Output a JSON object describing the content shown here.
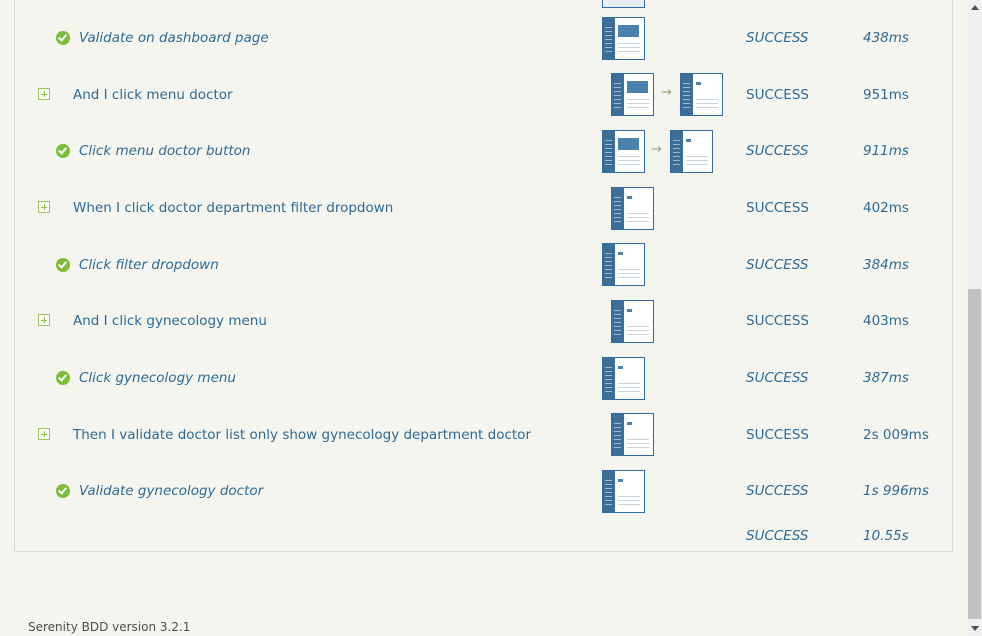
{
  "steps": [
    {
      "kind": "sub",
      "label": "Validate on dashboard page",
      "status": "SUCCESS",
      "time": "438ms",
      "thumbs": [
        "dashboard"
      ]
    },
    {
      "kind": "step",
      "label": "And I click menu doctor",
      "status": "SUCCESS",
      "time": "951ms",
      "thumbs": [
        "dashboard",
        "doctor"
      ]
    },
    {
      "kind": "sub",
      "label": "Click menu doctor button",
      "status": "SUCCESS",
      "time": "911ms",
      "thumbs": [
        "dashboard",
        "doctor"
      ]
    },
    {
      "kind": "step",
      "label": "When I click doctor department filter dropdown",
      "status": "SUCCESS",
      "time": "402ms",
      "thumbs": [
        "doctor"
      ]
    },
    {
      "kind": "sub",
      "label": "Click filter dropdown",
      "status": "SUCCESS",
      "time": "384ms",
      "thumbs": [
        "doctor"
      ]
    },
    {
      "kind": "step",
      "label": "And I click gynecology menu",
      "status": "SUCCESS",
      "time": "403ms",
      "thumbs": [
        "doctor"
      ]
    },
    {
      "kind": "sub",
      "label": "Click gynecology menu",
      "status": "SUCCESS",
      "time": "387ms",
      "thumbs": [
        "doctor"
      ]
    },
    {
      "kind": "step",
      "label": "Then I validate doctor list only show gynecology department doctor",
      "status": "SUCCESS",
      "time": "2s 009ms",
      "thumbs": [
        "list"
      ]
    },
    {
      "kind": "sub",
      "label": "Validate gynecology doctor",
      "status": "SUCCESS",
      "time": "1s 996ms",
      "thumbs": [
        "list"
      ]
    }
  ],
  "total": {
    "status": "SUCCESS",
    "time": "10.55s"
  },
  "footer": {
    "version": "Serenity BDD version 3.2.1"
  }
}
